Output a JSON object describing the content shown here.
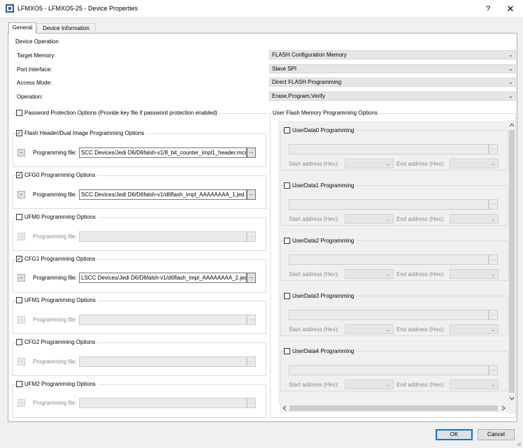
{
  "window": {
    "title": "LFMXO5 - LFMXO5-25 - Device Properties",
    "help_label": "?",
    "close_label": "✕"
  },
  "tabs": [
    {
      "label": "General"
    },
    {
      "label": "Device Information"
    }
  ],
  "device_operation": {
    "group_title": "Device Operation",
    "rows": [
      {
        "label": "Target Memory:",
        "value": "FLASH Configuration Memory"
      },
      {
        "label": "Port Interface:",
        "value": "Slave SPI"
      },
      {
        "label": "Access Mode:",
        "value": "Direct FLASH Programming"
      },
      {
        "label": "Operation:",
        "value": "Erase,Program,Verify"
      }
    ]
  },
  "password": {
    "label": "Password Protection Options (Provide key file if password protection enabled)",
    "checked": false
  },
  "programming_groups": [
    {
      "title": "Flash Header/Dual Image Programming Options",
      "checked": true,
      "file_label": "Programming file:",
      "file": "SCC Devices/Jedi D6/D6falsh-v1/8_bit_counter_impl1_header.mcs",
      "browse": "..."
    },
    {
      "title": "CFG0 Programming Options",
      "checked": true,
      "file_label": "Programming file:",
      "file": "SCC Devices/Jedi D6/D6falsh-v1/d6flash_impl_AAAAAAAA_1.jed",
      "browse": "..."
    },
    {
      "title": "UFM0 Programming Options",
      "checked": false,
      "file_label": "Programming file:",
      "file": "",
      "browse": "..."
    },
    {
      "title": "CFG1 Programming Options",
      "checked": true,
      "file_label": "Programming file:",
      "file": "LSCC Devices/Jedi D6/D6falsh-v1/d6flash_impl_AAAAAAAA_2.jed",
      "browse": "..."
    },
    {
      "title": "UFM1 Programming Options",
      "checked": false,
      "file_label": "Programming file:",
      "file": "",
      "browse": "..."
    },
    {
      "title": "CFG2 Programming Options",
      "checked": false,
      "file_label": "Programming file:",
      "file": "",
      "browse": "..."
    },
    {
      "title": "UFM2 Programming Options",
      "checked": false,
      "file_label": "Programming file:",
      "file": "",
      "browse": "..."
    }
  ],
  "user_flash": {
    "group_title": "User Flash Memory Programming Options",
    "start_label": "Start address (Hex):",
    "end_label": "End address (Hex):",
    "items": [
      {
        "title": "UserData0 Programming",
        "checked": false
      },
      {
        "title": "UserData1 Programming",
        "checked": false
      },
      {
        "title": "UserData2 Programming",
        "checked": false
      },
      {
        "title": "UserData3 Programming",
        "checked": false
      },
      {
        "title": "UserData4 Programming",
        "checked": false
      }
    ]
  },
  "footer": {
    "ok_label": "OK",
    "cancel_label": "Cancel"
  },
  "icons": {
    "minus": "-",
    "chevron": "⌄",
    "check": "✓",
    "ellipsis": "..."
  },
  "colors": {
    "accent": "#0078d7",
    "panel_bg": "#ffffff",
    "window_bg": "#f0f0f0"
  }
}
